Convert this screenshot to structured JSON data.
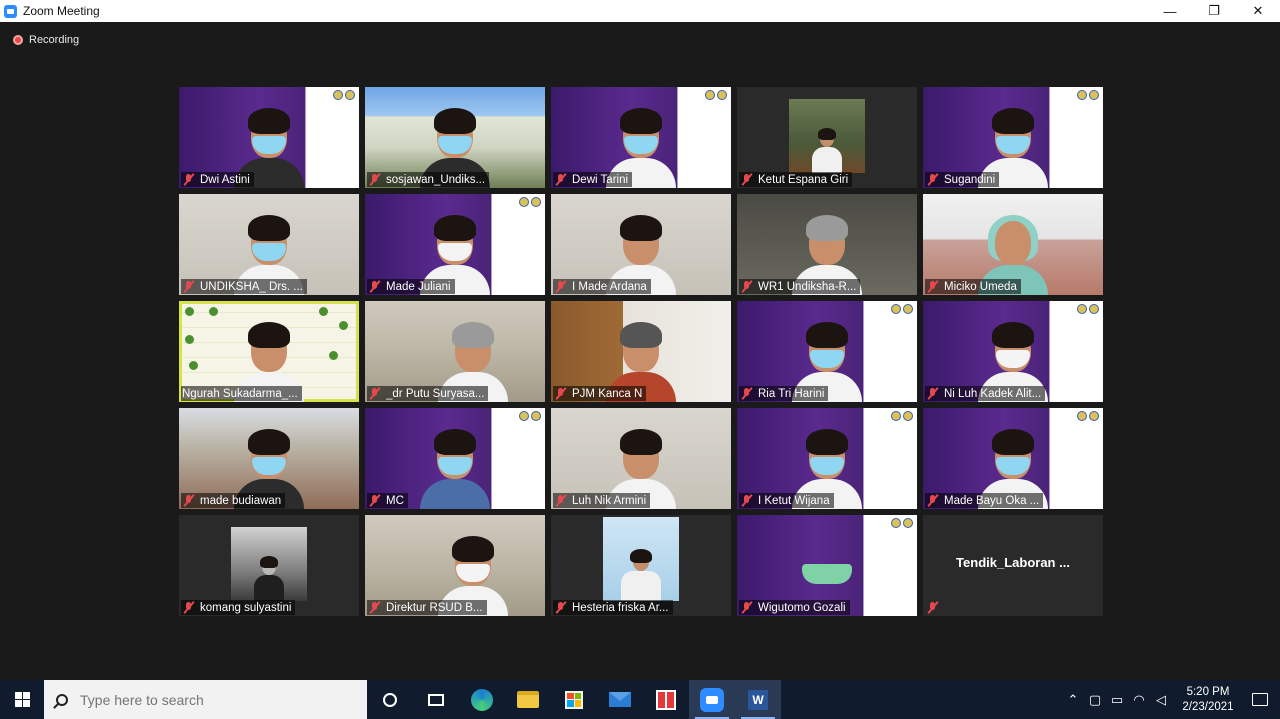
{
  "window": {
    "title": "Zoom Meeting",
    "minimize": "—",
    "restore": "❐",
    "close": "✕"
  },
  "meeting": {
    "recording_label": "Recording"
  },
  "participants": [
    {
      "name": "Dwi Astini"
    },
    {
      "name": "sosjawan_Undiks..."
    },
    {
      "name": "Dewi Tarini"
    },
    {
      "name": "Ketut Espana Giri"
    },
    {
      "name": "Sugandini"
    },
    {
      "name": "UNDIKSHA_ Drs. ..."
    },
    {
      "name": "Made Juliani"
    },
    {
      "name": "I Made Ardana"
    },
    {
      "name": "WR1 Undiksha-R..."
    },
    {
      "name": "Miciko Umeda"
    },
    {
      "name": "Ngurah Sukadarma_..."
    },
    {
      "name": "_dr Putu Suryasa..."
    },
    {
      "name": "PJM Kanca N"
    },
    {
      "name": "Ria Tri Harini"
    },
    {
      "name": "Ni Luh Kadek Alit..."
    },
    {
      "name": "made budiawan"
    },
    {
      "name": "MC"
    },
    {
      "name": "Luh Nik Armini"
    },
    {
      "name": "I Ketut Wijana"
    },
    {
      "name": "Made Bayu Oka ..."
    },
    {
      "name": "komang sulyastini"
    },
    {
      "name": "Direktur RSUD B..."
    },
    {
      "name": "Hesteria friska Ar..."
    },
    {
      "name": "Wigutomo Gozali"
    },
    {
      "name": "Tendik_Laboran ..."
    }
  ],
  "taskbar": {
    "search_placeholder": "Type here to search",
    "time": "5:20 PM",
    "date": "2/23/2021"
  }
}
